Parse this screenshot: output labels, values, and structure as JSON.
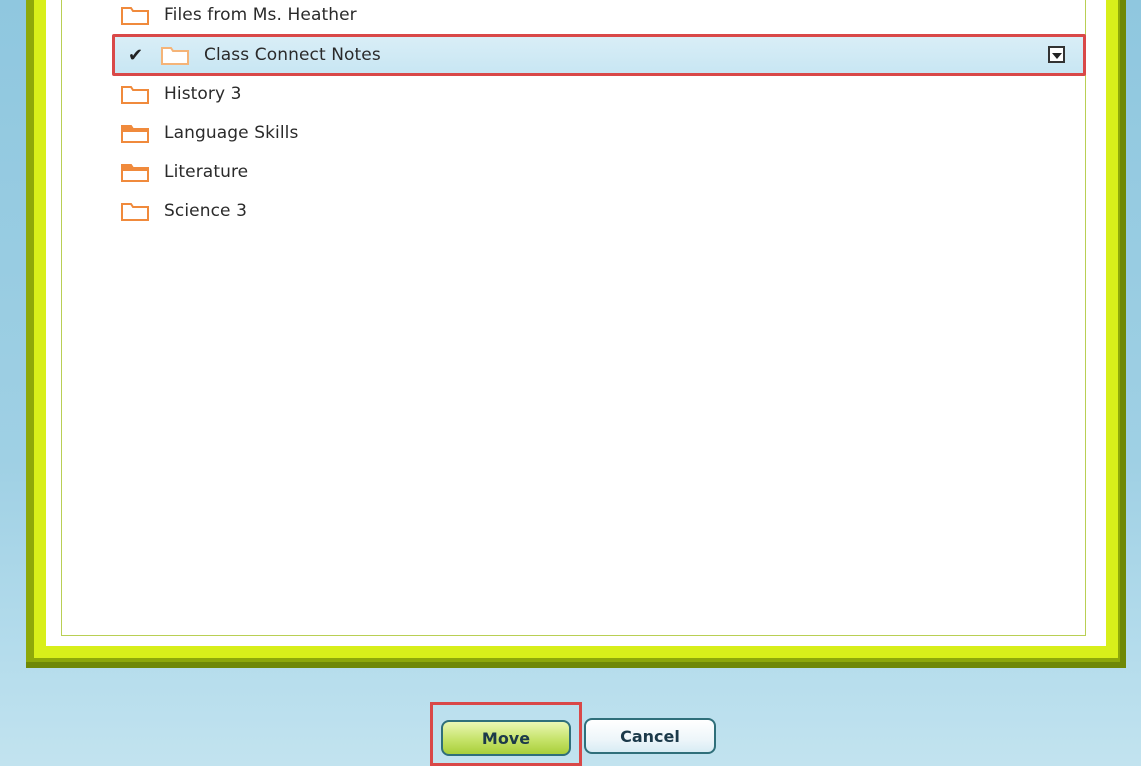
{
  "folders": [
    {
      "label": "Files from Ms. Heather",
      "icon": "folder-outline-icon"
    },
    {
      "label": "Class Connect Notes",
      "icon": "folder-outline-icon",
      "selected": true
    },
    {
      "label": "History 3",
      "icon": "folder-outline-icon"
    },
    {
      "label": "Language Skills",
      "icon": "folder-filled-icon"
    },
    {
      "label": "Literature",
      "icon": "folder-filled-icon"
    },
    {
      "label": "Science 3",
      "icon": "folder-outline-icon"
    }
  ],
  "selected_check": "✔",
  "buttons": {
    "move_label": "Move",
    "cancel_label": "Cancel"
  },
  "colors": {
    "frame_green": "#8ea80a",
    "frame_lime": "#d8ef1a",
    "folder_orange": "#f08a3c",
    "highlight_red": "#d94848",
    "selected_row": "#cfe9f5"
  }
}
